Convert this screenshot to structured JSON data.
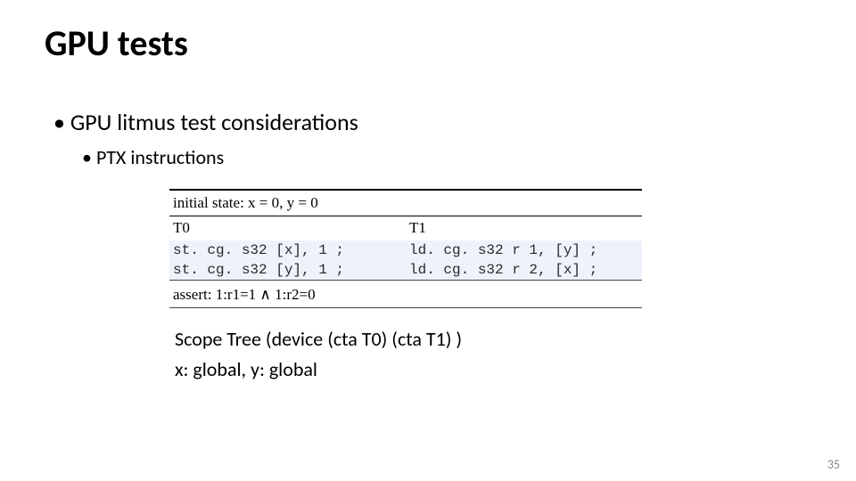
{
  "title": "GPU tests",
  "bullet_level1": "GPU litmus test considerations",
  "bullet_level2": "PTX instructions",
  "litmus": {
    "initial_state_label": "initial state:",
    "initial_state_expr": "x = 0, y = 0",
    "threads": {
      "left": "T0",
      "right": "T1"
    },
    "rows": [
      {
        "left": "st. cg. s32  [x],  1  ;",
        "right": "ld. cg. s32  r 1,  [y]  ;"
      },
      {
        "left": "st. cg. s32  [y],  1  ;",
        "right": "ld. cg. s32  r 2,  [x]  ;"
      }
    ],
    "assert_label": "assert:",
    "assert_expr": "1:r1=1 ∧ 1:r2=0"
  },
  "caption_line1": "Scope Tree (device (cta T0) (cta T1) )",
  "caption_line2": "x: global, y: global",
  "page_number": "35"
}
